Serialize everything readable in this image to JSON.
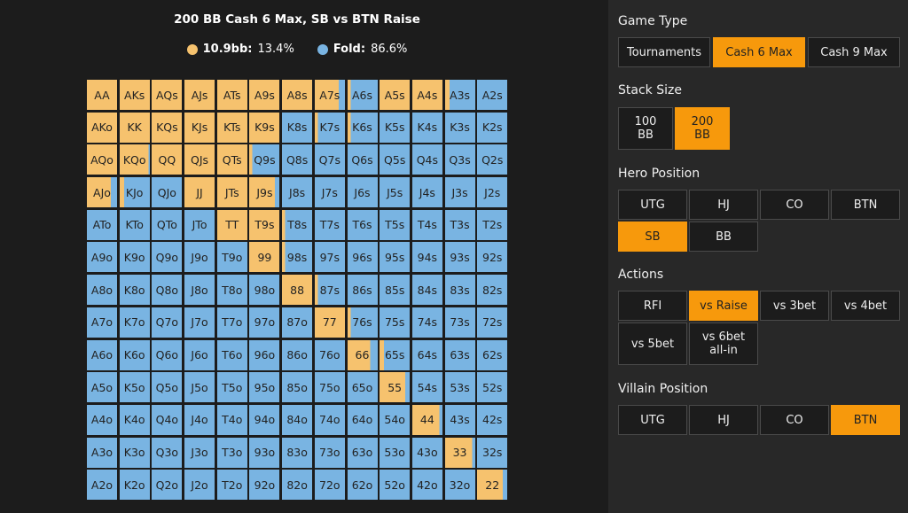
{
  "chart_title": "200 BB Cash 6 Max, SB vs BTN Raise",
  "legend": [
    {
      "label": "10.9bb:",
      "value": "13.4%",
      "color": "#f6c26e"
    },
    {
      "label": "Fold:",
      "value": "86.6%",
      "color": "#79b4e2"
    }
  ],
  "colors": {
    "raise": "#f6c26e",
    "fold": "#79b4e2",
    "accent": "#f7990c"
  },
  "grid": {
    "rows": [
      [
        [
          "AA",
          1
        ],
        [
          "AKs",
          1
        ],
        [
          "AQs",
          1
        ],
        [
          "AJs",
          1
        ],
        [
          "ATs",
          1
        ],
        [
          "A9s",
          1
        ],
        [
          "A8s",
          1
        ],
        [
          "A7s",
          0.8
        ],
        [
          "A6s",
          0.1
        ],
        [
          "A5s",
          1
        ],
        [
          "A4s",
          1
        ],
        [
          "A3s",
          0.15
        ],
        [
          "A2s",
          0
        ]
      ],
      [
        [
          "AKo",
          1
        ],
        [
          "KK",
          1
        ],
        [
          "KQs",
          1
        ],
        [
          "KJs",
          1
        ],
        [
          "KTs",
          1
        ],
        [
          "K9s",
          1
        ],
        [
          "K8s",
          0
        ],
        [
          "K7s",
          0.1
        ],
        [
          "K6s",
          0.1
        ],
        [
          "K5s",
          0
        ],
        [
          "K4s",
          0
        ],
        [
          "K3s",
          0
        ],
        [
          "K2s",
          0
        ]
      ],
      [
        [
          "AQo",
          1
        ],
        [
          "KQo",
          0.95
        ],
        [
          "QQ",
          1
        ],
        [
          "QJs",
          1
        ],
        [
          "QTs",
          1
        ],
        [
          "Q9s",
          0.1
        ],
        [
          "Q8s",
          0
        ],
        [
          "Q7s",
          0
        ],
        [
          "Q6s",
          0
        ],
        [
          "Q5s",
          0
        ],
        [
          "Q4s",
          0
        ],
        [
          "Q3s",
          0
        ],
        [
          "Q2s",
          0
        ]
      ],
      [
        [
          "AJo",
          0.8
        ],
        [
          "KJo",
          0.15
        ],
        [
          "QJo",
          0
        ],
        [
          "JJ",
          1
        ],
        [
          "JTs",
          1
        ],
        [
          "J9s",
          0.85
        ],
        [
          "J8s",
          0
        ],
        [
          "J7s",
          0
        ],
        [
          "J6s",
          0
        ],
        [
          "J5s",
          0
        ],
        [
          "J4s",
          0
        ],
        [
          "J3s",
          0
        ],
        [
          "J2s",
          0
        ]
      ],
      [
        [
          "ATo",
          0
        ],
        [
          "KTo",
          0
        ],
        [
          "QTo",
          0
        ],
        [
          "JTo",
          0
        ],
        [
          "TT",
          1
        ],
        [
          "T9s",
          1
        ],
        [
          "T8s",
          0.1
        ],
        [
          "T7s",
          0
        ],
        [
          "T6s",
          0
        ],
        [
          "T5s",
          0
        ],
        [
          "T4s",
          0
        ],
        [
          "T3s",
          0
        ],
        [
          "T2s",
          0
        ]
      ],
      [
        [
          "A9o",
          0
        ],
        [
          "K9o",
          0
        ],
        [
          "Q9o",
          0
        ],
        [
          "J9o",
          0
        ],
        [
          "T9o",
          0
        ],
        [
          "99",
          1
        ],
        [
          "98s",
          0.1
        ],
        [
          "97s",
          0
        ],
        [
          "96s",
          0
        ],
        [
          "95s",
          0
        ],
        [
          "94s",
          0
        ],
        [
          "93s",
          0
        ],
        [
          "92s",
          0
        ]
      ],
      [
        [
          "A8o",
          0
        ],
        [
          "K8o",
          0
        ],
        [
          "Q8o",
          0
        ],
        [
          "J8o",
          0
        ],
        [
          "T8o",
          0
        ],
        [
          "98o",
          0
        ],
        [
          "88",
          1
        ],
        [
          "87s",
          0.1
        ],
        [
          "86s",
          0
        ],
        [
          "85s",
          0
        ],
        [
          "84s",
          0
        ],
        [
          "83s",
          0
        ],
        [
          "82s",
          0
        ]
      ],
      [
        [
          "A7o",
          0
        ],
        [
          "K7o",
          0
        ],
        [
          "Q7o",
          0
        ],
        [
          "J7o",
          0
        ],
        [
          "T7o",
          0
        ],
        [
          "97o",
          0
        ],
        [
          "87o",
          0
        ],
        [
          "77",
          1
        ],
        [
          "76s",
          0.1
        ],
        [
          "75s",
          0
        ],
        [
          "74s",
          0
        ],
        [
          "73s",
          0
        ],
        [
          "72s",
          0
        ]
      ],
      [
        [
          "A6o",
          0
        ],
        [
          "K6o",
          0
        ],
        [
          "Q6o",
          0
        ],
        [
          "J6o",
          0
        ],
        [
          "T6o",
          0
        ],
        [
          "96o",
          0
        ],
        [
          "86o",
          0
        ],
        [
          "76o",
          0
        ],
        [
          "66",
          0.75
        ],
        [
          "65s",
          0.15
        ],
        [
          "64s",
          0
        ],
        [
          "63s",
          0
        ],
        [
          "62s",
          0
        ]
      ],
      [
        [
          "A5o",
          0
        ],
        [
          "K5o",
          0
        ],
        [
          "Q5o",
          0
        ],
        [
          "J5o",
          0
        ],
        [
          "T5o",
          0
        ],
        [
          "95o",
          0
        ],
        [
          "85o",
          0
        ],
        [
          "75o",
          0
        ],
        [
          "65o",
          0
        ],
        [
          "55",
          0.85
        ],
        [
          "54s",
          0
        ],
        [
          "53s",
          0
        ],
        [
          "52s",
          0
        ]
      ],
      [
        [
          "A4o",
          0
        ],
        [
          "K4o",
          0
        ],
        [
          "Q4o",
          0
        ],
        [
          "J4o",
          0
        ],
        [
          "T4o",
          0
        ],
        [
          "94o",
          0
        ],
        [
          "84o",
          0
        ],
        [
          "74o",
          0
        ],
        [
          "64o",
          0
        ],
        [
          "54o",
          0
        ],
        [
          "44",
          0.9
        ],
        [
          "43s",
          0
        ],
        [
          "42s",
          0
        ]
      ],
      [
        [
          "A3o",
          0
        ],
        [
          "K3o",
          0
        ],
        [
          "Q3o",
          0
        ],
        [
          "J3o",
          0
        ],
        [
          "T3o",
          0
        ],
        [
          "93o",
          0
        ],
        [
          "83o",
          0
        ],
        [
          "73o",
          0
        ],
        [
          "63o",
          0
        ],
        [
          "53o",
          0
        ],
        [
          "43o",
          0
        ],
        [
          "33",
          0.9
        ],
        [
          "32s",
          0
        ]
      ],
      [
        [
          "A2o",
          0
        ],
        [
          "K2o",
          0
        ],
        [
          "Q2o",
          0
        ],
        [
          "J2o",
          0
        ],
        [
          "T2o",
          0
        ],
        [
          "92o",
          0
        ],
        [
          "82o",
          0
        ],
        [
          "72o",
          0
        ],
        [
          "62o",
          0
        ],
        [
          "52o",
          0
        ],
        [
          "42o",
          0
        ],
        [
          "32o",
          0
        ],
        [
          "22",
          0.85
        ]
      ]
    ]
  },
  "panel": {
    "game_type": {
      "title": "Game Type",
      "options": [
        "Tournaments",
        "Cash 6 Max",
        "Cash 9 Max"
      ],
      "active": 1
    },
    "stack_size": {
      "title": "Stack Size",
      "options": [
        "100\nBB",
        "200\nBB"
      ],
      "active": 1
    },
    "hero_position": {
      "title": "Hero Position",
      "options": [
        "UTG",
        "HJ",
        "CO",
        "BTN",
        "SB",
        "BB"
      ],
      "active": 4
    },
    "actions": {
      "title": "Actions",
      "options": [
        "RFI",
        "vs Raise",
        "vs 3bet",
        "vs 4bet",
        "vs 5bet",
        "vs 6bet\nall-in"
      ],
      "active": 1
    },
    "villain_position": {
      "title": "Villain Position",
      "options": [
        "UTG",
        "HJ",
        "CO",
        "BTN"
      ],
      "active": 3
    }
  }
}
